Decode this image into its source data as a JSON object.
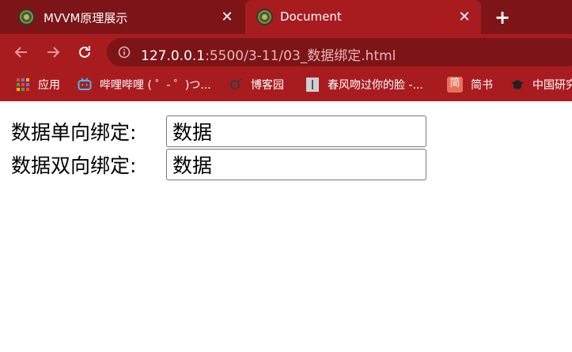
{
  "browser": {
    "tabs": [
      {
        "title": "MVVM原理展示",
        "active": false
      },
      {
        "title": "Document",
        "active": true
      }
    ],
    "new_tab_label": "+",
    "close_glyph": "✕",
    "url": {
      "host": "127.0.0.1",
      "rest": ":5500/3-11/03_数据绑定.html"
    },
    "bookmarks": [
      {
        "label": "应用",
        "icon": "apps-grid-icon"
      },
      {
        "label": "哔哩哔哩 ( ゜- ゜)つ...",
        "icon": "bilibili-icon"
      },
      {
        "label": "博客园",
        "icon": "cnblogs-icon"
      },
      {
        "label": "春风吻过你的脸 -...",
        "icon": "page-icon"
      },
      {
        "label": "简书",
        "icon": "jianshu-icon"
      },
      {
        "label": "中国研究",
        "icon": "mortarboard-icon"
      }
    ],
    "colors": {
      "frame": "#7d1417",
      "toolbar": "#a81c20"
    }
  },
  "page": {
    "one_way_label": "数据单向绑定:",
    "one_way_value": "数据",
    "two_way_label": "数据双向绑定:",
    "two_way_value": "数据"
  }
}
